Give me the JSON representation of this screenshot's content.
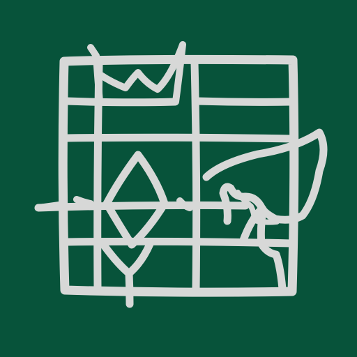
{
  "colors": {
    "background": "#07533A",
    "mark": "#D7D8D7"
  },
  "logo": {
    "icon": "lattice-window-crown-leaf-icon"
  }
}
